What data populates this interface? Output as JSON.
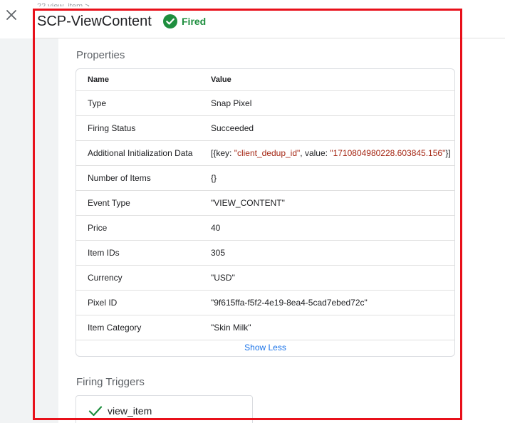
{
  "breadcrumb": "22 view_item >",
  "tag": {
    "title": "SCP-ViewContent",
    "status_label": "Fired",
    "status_icon": "check-circle-icon",
    "status_color": "#1e8e3e"
  },
  "properties": {
    "section_title": "Properties",
    "columns": {
      "name": "Name",
      "value": "Value"
    },
    "rows": [
      {
        "name": "Type",
        "value": "Snap Pixel",
        "kind": "plain"
      },
      {
        "name": "Firing Status",
        "value": "Succeeded",
        "kind": "plain"
      },
      {
        "name": "Additional Initialization Data",
        "value_prefix": "[{key: ",
        "value_key": "\"client_dedup_id\"",
        "value_mid": ", value: ",
        "value_val": "\"1710804980228.603845.156\"",
        "value_suffix": "}]",
        "kind": "mixed"
      },
      {
        "name": "Number of Items",
        "value": "{}",
        "kind": "plain"
      },
      {
        "name": "Event Type",
        "value": "\"VIEW_CONTENT\"",
        "kind": "string"
      },
      {
        "name": "Price",
        "value": "40",
        "kind": "number"
      },
      {
        "name": "Item IDs",
        "value": "305",
        "kind": "number"
      },
      {
        "name": "Currency",
        "value": "\"USD\"",
        "kind": "string"
      },
      {
        "name": "Pixel ID",
        "value": "\"9f615ffa-f5f2-4e19-8ea4-5cad7ebed72c\"",
        "kind": "string"
      },
      {
        "name": "Item Category",
        "value": "\"Skin Milk\"",
        "kind": "string"
      }
    ],
    "show_less_label": "Show Less"
  },
  "firing_triggers": {
    "section_title": "Firing Triggers",
    "items": [
      {
        "label": "view_item",
        "icon": "checkmark-icon"
      }
    ]
  },
  "colors": {
    "accent": "#1a73e8",
    "string_value": "#a52714",
    "number_value": "#0d652d",
    "highlight": "#e8101a"
  }
}
